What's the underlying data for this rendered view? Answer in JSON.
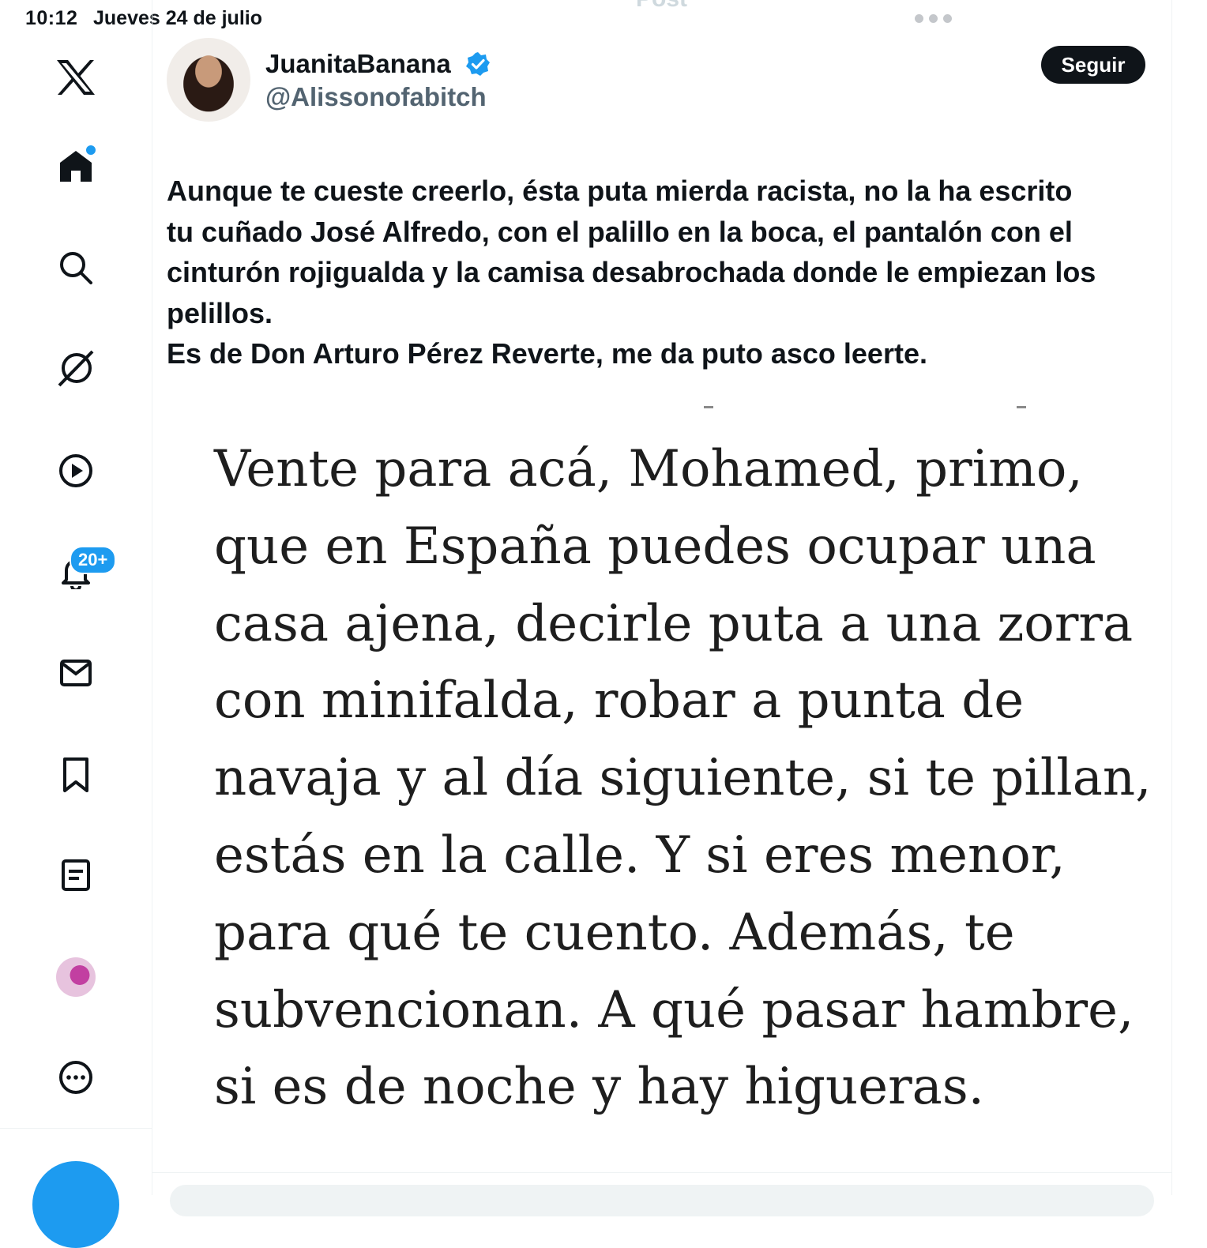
{
  "status_bar": {
    "time": "10:12",
    "date": "Jueves 24 de julio"
  },
  "header": {
    "title_partial": "Post"
  },
  "sidebar": {
    "items": [
      {
        "name": "x-logo-icon"
      },
      {
        "name": "home-icon"
      },
      {
        "name": "search-icon"
      },
      {
        "name": "grok-icon"
      },
      {
        "name": "video-icon"
      },
      {
        "name": "notifications-icon"
      },
      {
        "name": "messages-icon"
      },
      {
        "name": "bookmarks-icon"
      },
      {
        "name": "lists-icon"
      },
      {
        "name": "profile-avatar"
      },
      {
        "name": "more-icon"
      }
    ],
    "notifications_badge": "20+"
  },
  "tweet": {
    "display_name": "JuanitaBanana",
    "handle": "@Alissonofabitch",
    "verified": true,
    "follow_label": "Seguir",
    "text": "Aunque te cueste creerlo, ésta puta mierda racista, no la ha escrito\ntu cuñado José Alfredo, con el palillo en la boca, el pantalón con el\ncinturón rojigualda y la camisa desabrochada donde le empiezan los\npelillos.\nEs de Don Arturo Pérez Reverte, me da puto asco leerte.",
    "media_text_lines": [
      "Vente para acá, Mohamed, primo,",
      "que en España puedes ocupar una",
      "casa ajena, decirle puta a una zorra",
      "con minifalda, robar a punta de",
      "navaja y al día siguiente, si te pillan,",
      "estás en la calle. Y si eres menor,",
      "para qué te cuento. Además, te",
      "subvencionan. A qué pasar hambre,",
      "si es de noche y hay higueras."
    ]
  },
  "colors": {
    "accent": "#1d9bf0",
    "text": "#0f1419",
    "secondary": "#536471"
  }
}
